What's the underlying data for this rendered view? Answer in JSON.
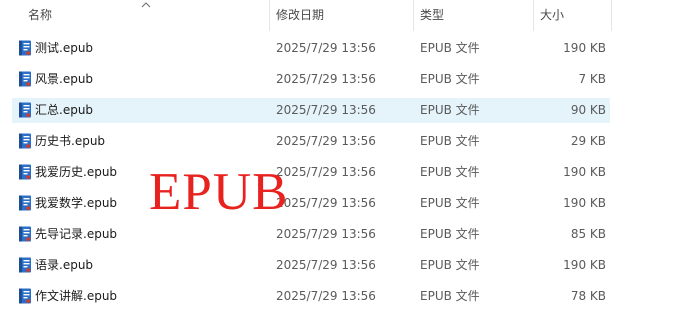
{
  "columns": {
    "name": "名称",
    "date": "修改日期",
    "type": "类型",
    "size": "大小"
  },
  "files": [
    {
      "name": "测试.epub",
      "date": "2025/7/29 13:56",
      "type": "EPUB 文件",
      "size": "190 KB",
      "selected": false
    },
    {
      "name": "风景.epub",
      "date": "2025/7/29 13:56",
      "type": "EPUB 文件",
      "size": "7 KB",
      "selected": false
    },
    {
      "name": "汇总.epub",
      "date": "2025/7/29 13:56",
      "type": "EPUB 文件",
      "size": "90 KB",
      "selected": true
    },
    {
      "name": "历史书.epub",
      "date": "2025/7/29 13:56",
      "type": "EPUB 文件",
      "size": "29 KB",
      "selected": false
    },
    {
      "name": "我爱历史.epub",
      "date": "2025/7/29 13:56",
      "type": "EPUB 文件",
      "size": "190 KB",
      "selected": false
    },
    {
      "name": "我爱数学.epub",
      "date": "2025/7/29 13:56",
      "type": "EPUB 文件",
      "size": "190 KB",
      "selected": false
    },
    {
      "name": "先导记录.epub",
      "date": "2025/7/29 13:56",
      "type": "EPUB 文件",
      "size": "85 KB",
      "selected": false
    },
    {
      "name": "语录.epub",
      "date": "2025/7/29 13:56",
      "type": "EPUB 文件",
      "size": "190 KB",
      "selected": false
    },
    {
      "name": "作文讲解.epub",
      "date": "2025/7/29 13:56",
      "type": "EPUB 文件",
      "size": "78 KB",
      "selected": false
    }
  ],
  "overlay_text": "EPUB",
  "colors": {
    "selection": "#e5f3fb",
    "overlay": "#e8231f",
    "icon_blue": "#2b6fc7",
    "icon_red": "#d33a2c"
  },
  "icons": {
    "sort": "chevron-up-icon",
    "file": "epub-file-icon"
  }
}
